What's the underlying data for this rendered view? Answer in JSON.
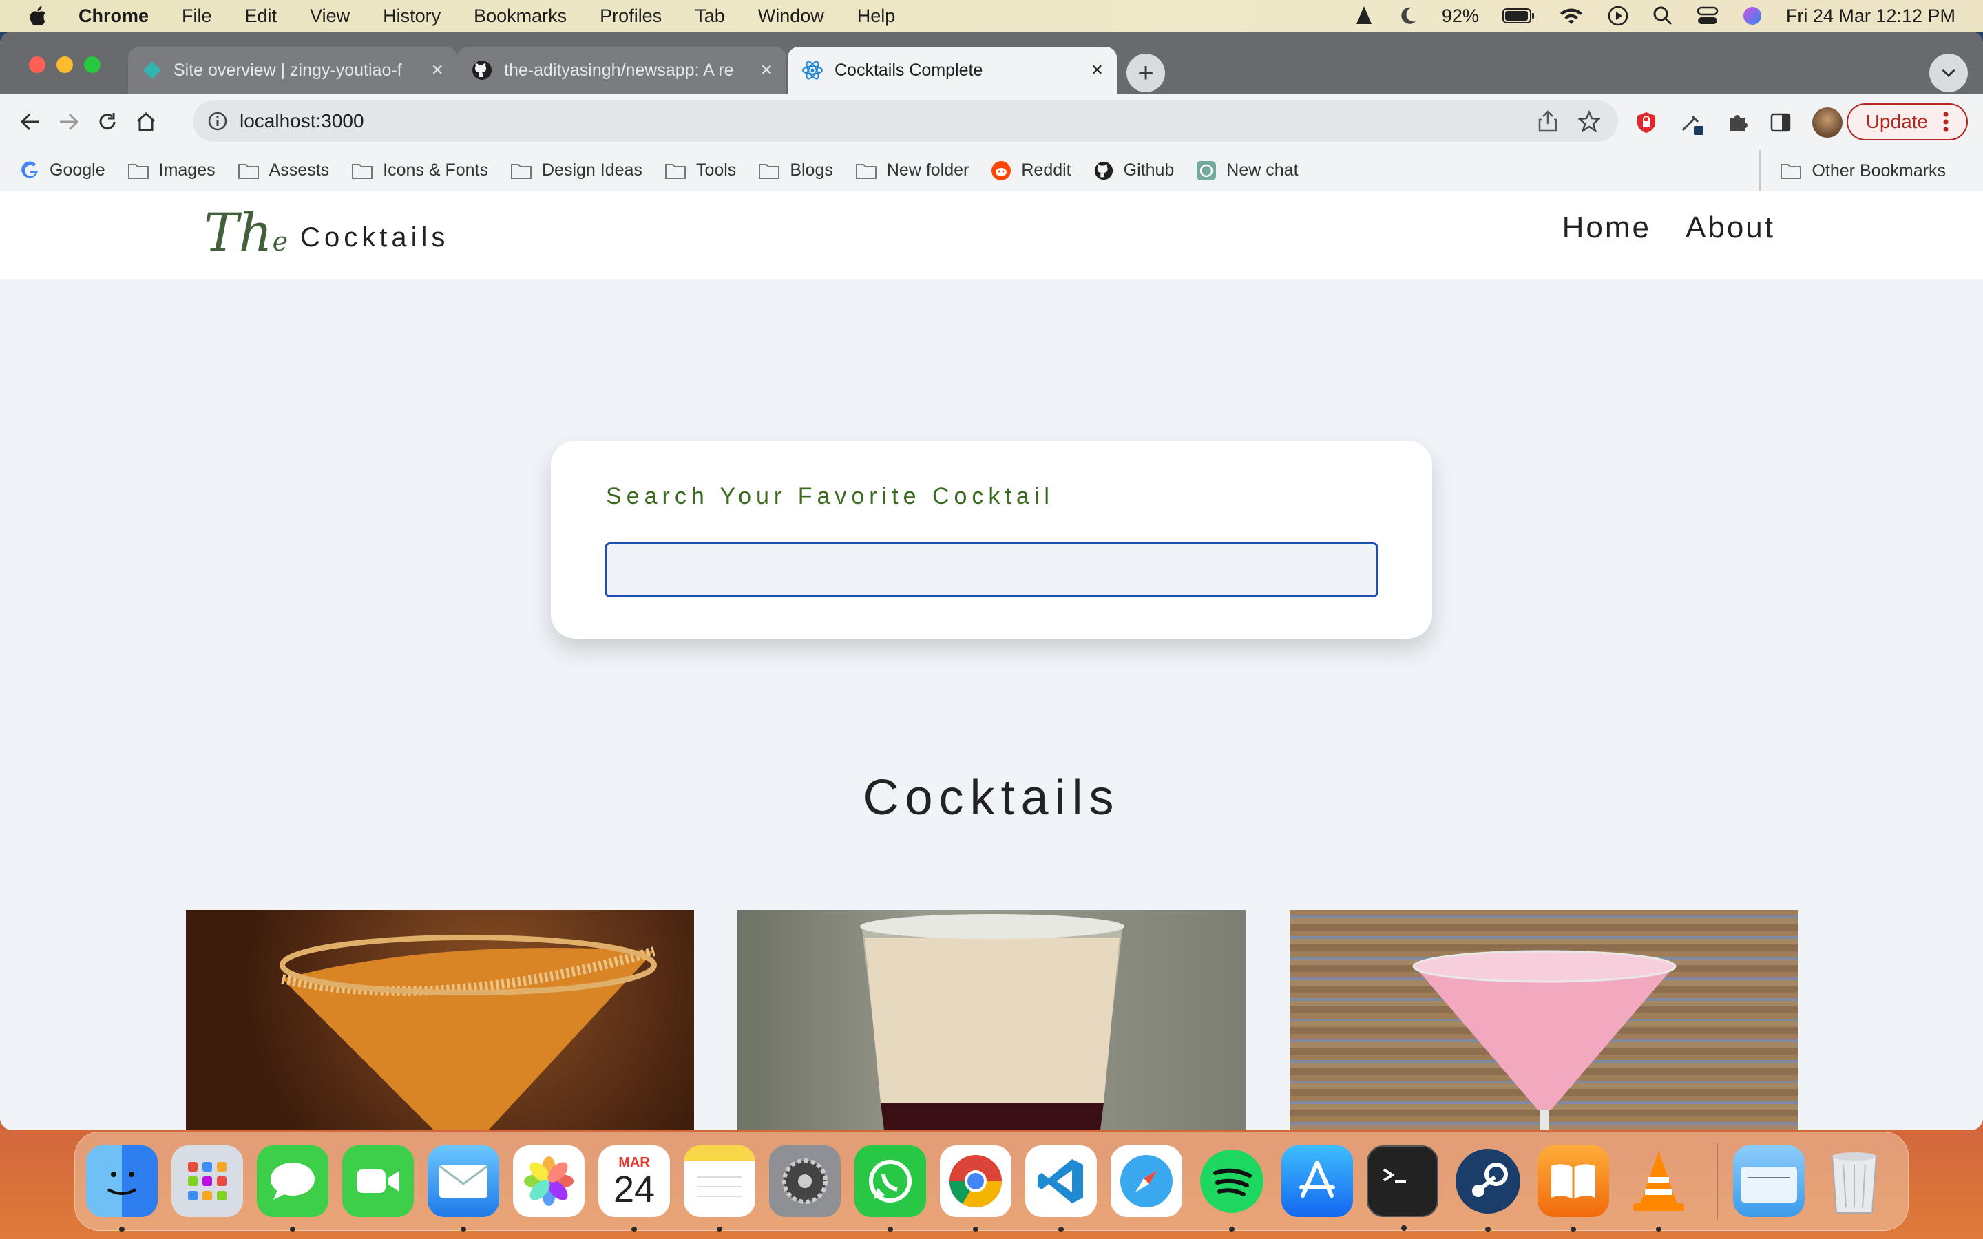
{
  "menubar": {
    "app": "Chrome",
    "menus": [
      "File",
      "Edit",
      "View",
      "History",
      "Bookmarks",
      "Profiles",
      "Tab",
      "Window",
      "Help"
    ],
    "battery": "92%",
    "datetime": "Fri 24 Mar  12:12 PM"
  },
  "browser": {
    "tabs": [
      {
        "title": "Site overview | zingy-youtiao-f",
        "icon": "netlify-icon"
      },
      {
        "title": "the-adityasingh/newsapp: A re",
        "icon": "github-icon"
      },
      {
        "title": "Cocktails Complete",
        "icon": "react-icon"
      }
    ],
    "url": "localhost:3000",
    "update_label": "Update",
    "bookmarks": [
      "Google",
      "Images",
      "Assests",
      "Icons & Fonts",
      "Design Ideas",
      "Tools",
      "Blogs",
      "New folder",
      "Reddit",
      "Github",
      "New chat"
    ],
    "other_bookmarks": "Other Bookmarks"
  },
  "site": {
    "logo_script": "Th",
    "logo_script_small": "e",
    "logo_word": "Cocktails",
    "nav": [
      "Home",
      "About"
    ],
    "search_label": "Search Your Favorite Cocktail",
    "search_value": "",
    "section_title": "Cocktails"
  },
  "dock": {
    "calendar_month": "MAR",
    "calendar_day": "24",
    "items": [
      "finder",
      "launchpad",
      "messages",
      "facetime",
      "mail",
      "photos",
      "calendar",
      "notes",
      "system-settings",
      "whatsapp",
      "chrome",
      "vscode",
      "safari",
      "spotify",
      "app-store",
      "terminal",
      "steam",
      "books",
      "vlc",
      "downloads",
      "trash"
    ]
  }
}
